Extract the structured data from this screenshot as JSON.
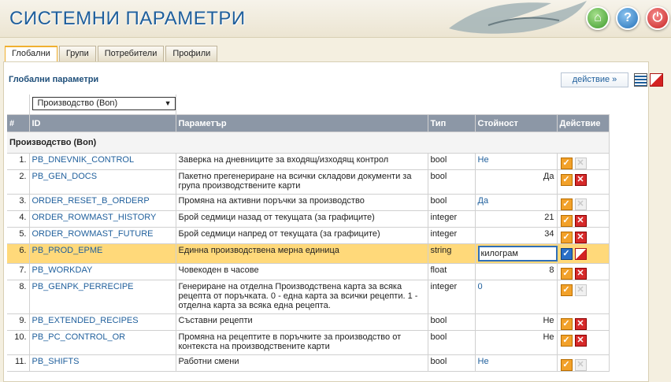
{
  "app": {
    "title": "СИСТЕМНИ ПАРАМЕТРИ"
  },
  "tabs": [
    "Глобални",
    "Групи",
    "Потребители",
    "Профили"
  ],
  "panel": {
    "title": "Глобални параметри",
    "action_label": "действие »"
  },
  "filter": {
    "selected": "Производство (Bon)"
  },
  "columns": [
    "#",
    "ID",
    "Параметър",
    "Тип",
    "Стойност",
    "Действие"
  ],
  "group": "Производство (Bon)",
  "rows": [
    {
      "num": "1.",
      "id": "PB_DNEVNIK_CONTROL",
      "param": "Заверка на дневниците за входящ/изходящ контрол",
      "type": "bool",
      "value": "Не",
      "align": "left",
      "blue": true,
      "del": false
    },
    {
      "num": "2.",
      "id": "PB_GEN_DOCS",
      "param": "Пакетно прегенериране на всички складови документи за група производствените карти",
      "type": "bool",
      "value": "Да",
      "align": "right",
      "blue": false,
      "del": true
    },
    {
      "num": "3.",
      "id": "ORDER_RESET_B_ORDERP",
      "param": "Промяна на активни поръчки за производство",
      "type": "bool",
      "value": "Да",
      "align": "left",
      "blue": true,
      "del": false
    },
    {
      "num": "4.",
      "id": "ORDER_ROWMAST_HISTORY",
      "param": "Брой седмици назад от текущата (за графиците)",
      "type": "integer",
      "value": "21",
      "align": "right",
      "blue": false,
      "del": true
    },
    {
      "num": "5.",
      "id": "ORDER_ROWMAST_FUTURE",
      "param": "Брой седмици напред от текущата (за графиците)",
      "type": "integer",
      "value": "34",
      "align": "right",
      "blue": false,
      "del": true
    },
    {
      "num": "6.",
      "id": "PB_PROD_EPME",
      "param": "Единна производствена мерна единица",
      "type": "string",
      "value": "килограм",
      "editing": true
    },
    {
      "num": "7.",
      "id": "PB_WORKDAY",
      "param": "Човекоден в часове",
      "type": "float",
      "value": "8",
      "align": "right",
      "blue": false,
      "del": true
    },
    {
      "num": "8.",
      "id": "PB_GENPK_PERRECIPE",
      "param": "Генериране на отделна Производствена карта за всяка рецепта от поръчката. 0 - една карта за всички рецепти. 1 - отделна карта за всяка една рецепта.",
      "type": "integer",
      "value": "0",
      "align": "left",
      "blue": true,
      "del": false
    },
    {
      "num": "9.",
      "id": "PB_EXTENDED_RECIPES",
      "param": "Съставни рецепти",
      "type": "bool",
      "value": "Не",
      "align": "right",
      "blue": false,
      "del": true
    },
    {
      "num": "10.",
      "id": "PB_PC_CONTROL_OR",
      "param": "Промяна на рецептите в поръчките за производство от контекста на производствените карти",
      "type": "bool",
      "value": "Не",
      "align": "right",
      "blue": false,
      "del": true
    },
    {
      "num": "11.",
      "id": "PB_SHIFTS",
      "param": "Работни смени",
      "type": "bool",
      "value": "Не",
      "align": "left",
      "blue": true,
      "del": false
    }
  ]
}
